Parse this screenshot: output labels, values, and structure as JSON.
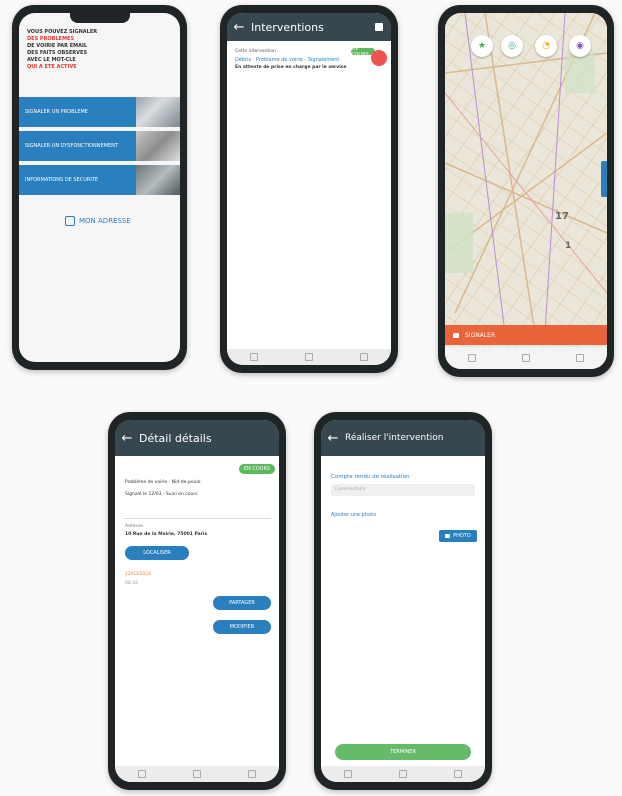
{
  "phone1": {
    "intro_lines": [
      "VOUS POUVEZ SIGNALER",
      "DES PROBLEMES",
      "DE VOIRIE PAR EMAIL",
      "DES FAITS OBSERVES",
      "AVEC LE MOT-CLE",
      "QUI A ETE ACTIVE"
    ],
    "tiles": [
      "SIGNALER UN PROBLEME",
      "SIGNALER UN DYSFONCTIONNEMENT",
      "INFORMATIONS DE SECURITE"
    ],
    "link_label": "MON ADRESSE"
  },
  "phone2": {
    "title": "Interventions",
    "card_small": "Cette intervention",
    "card_status": "EN COURS",
    "card_title": "Débris : Problème de voirie - Signalement",
    "card_body": "En attente de prise en charge par le service"
  },
  "phone3": {
    "map_labels": [
      "17",
      "1"
    ],
    "banner_label": "SIGNALER"
  },
  "phone4": {
    "title": "Détail détails",
    "badge": "EN COURS",
    "line1": "Problème de voirie - Nid-de-poule",
    "line2": "Signalé le 12/03 - Suivi en cours",
    "section_label": "Adresse",
    "address": "10 Rue de la Mairie, 75001 Paris",
    "btn_location": "LOCALISER",
    "date1": "12/03/2024",
    "date2": "08:42",
    "btn_share": "PARTAGER",
    "btn_edit": "MODIFIER"
  },
  "phone5": {
    "title": "Réaliser l'intervention",
    "comment_label": "Compte rendu de réalisation",
    "comment_placeholder": "Commentaire",
    "photo_label": "Ajouter une photo",
    "photo_btn": "PHOTO",
    "submit_label": "TERMINER"
  }
}
